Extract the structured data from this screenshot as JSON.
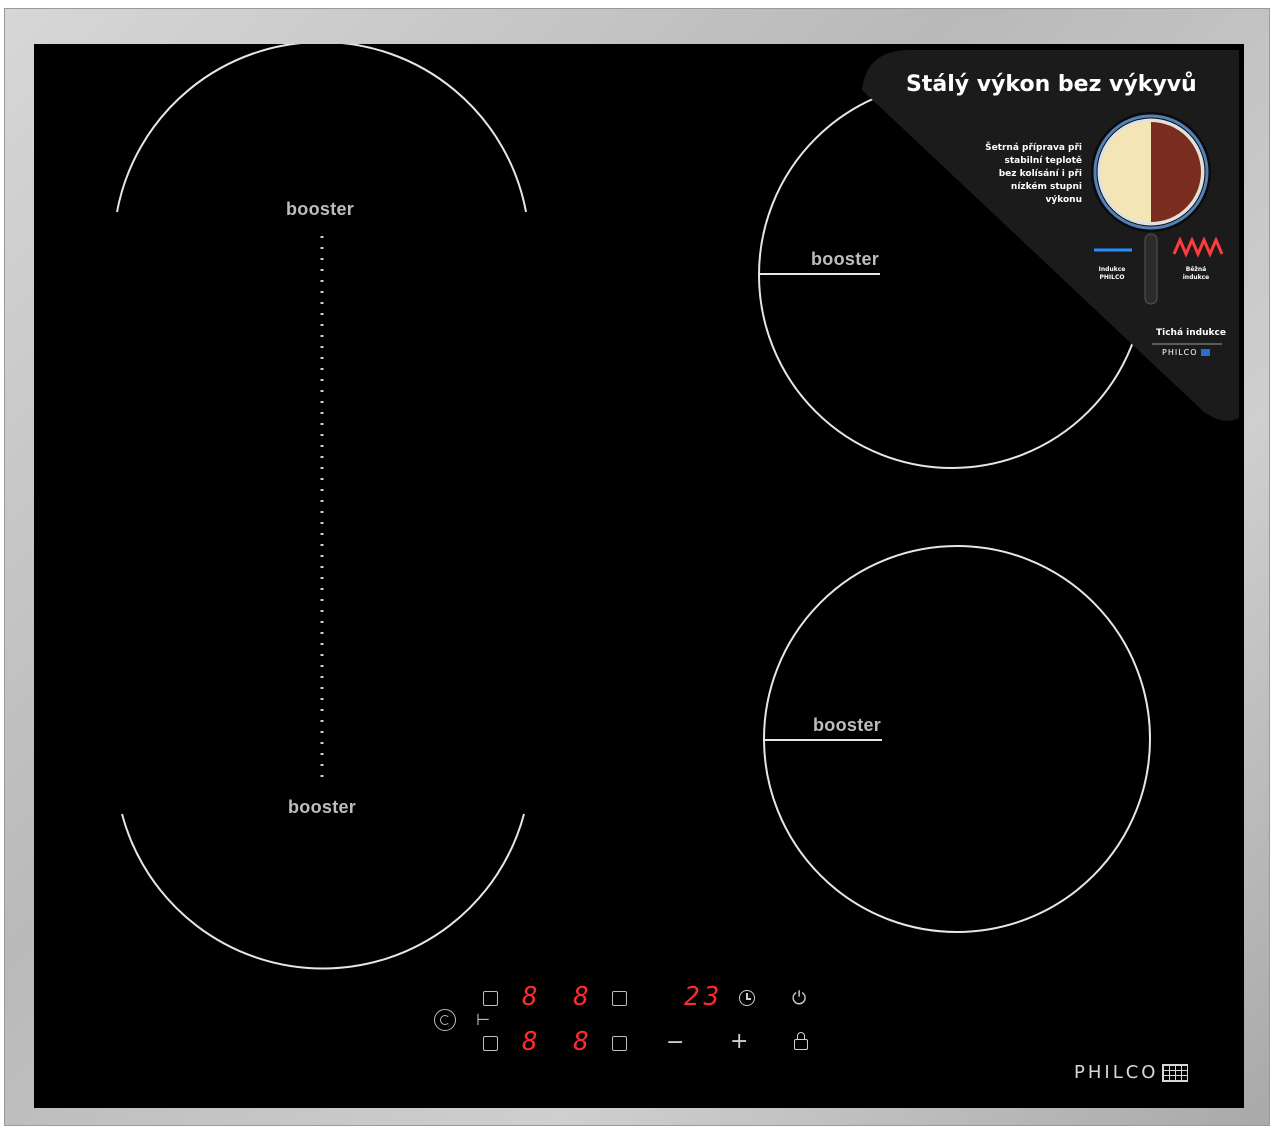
{
  "zones": {
    "bridge_top_label": "booster",
    "bridge_bottom_label": "booster",
    "top_right_label": "booster",
    "bottom_right_label": "booster"
  },
  "promo": {
    "headline": "Stálý výkon bez výkyvů",
    "description_lines": [
      "Šetrná příprava při",
      "stabilní teplotě",
      "bez kolísání i při",
      "nízkém stupni",
      "výkonu"
    ],
    "induction_philco_line1": "Indukce",
    "induction_philco_line2": "PHILCO",
    "induction_common_line1": "Běžná",
    "induction_common_line2": "indukce",
    "quiet_label": "Tichá indukce",
    "brand": "PHILCO"
  },
  "controls": {
    "display_top": "8 8",
    "display_bottom": "8 8",
    "timer_display": "23",
    "minus_label": "−",
    "plus_label": "+"
  },
  "brand": {
    "name": "PHILCO"
  },
  "colors": {
    "glass": "#000000",
    "frame": "#c4c4c4",
    "display": "#ff2a2a",
    "promo_panel": "#1a1a1a"
  }
}
